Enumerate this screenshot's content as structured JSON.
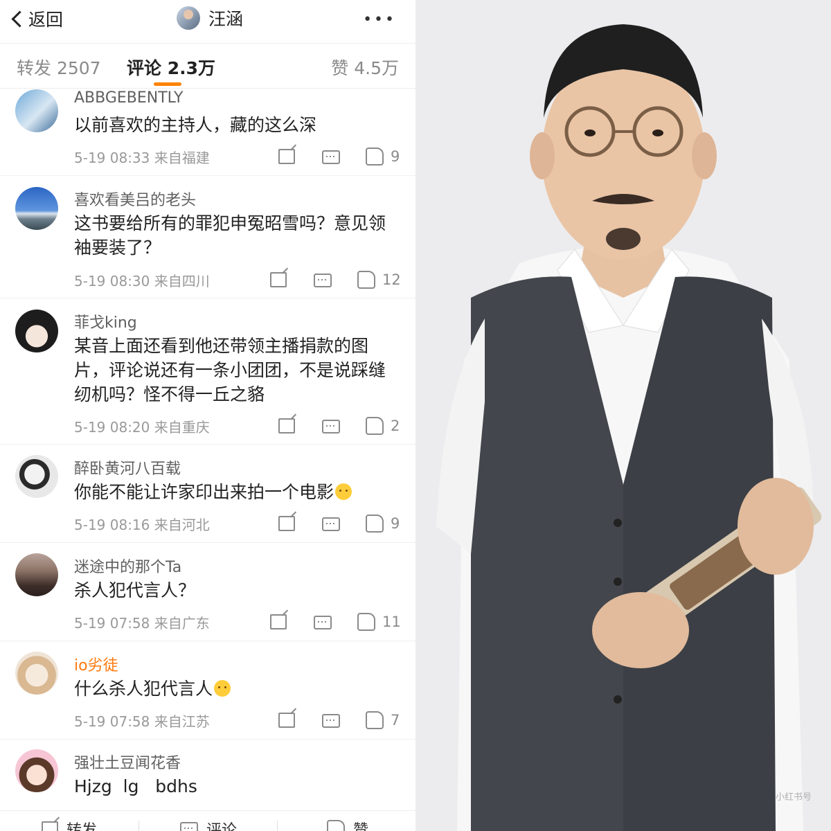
{
  "header": {
    "back_label": "返回",
    "title": "汪涵",
    "more": "•••"
  },
  "tabs": {
    "forward": "转发 2507",
    "comments": "评论 2.3万",
    "likes": "赞 4.5万"
  },
  "comments": [
    {
      "name": "ABBGEBENTLY",
      "text": "以前喜欢的主持人，藏的这么深",
      "meta": "5-19 08:33 来自福建",
      "likes": "9"
    },
    {
      "name": "喜欢看美吕的老头",
      "text": "这书要给所有的罪犯申冤昭雪吗？意见领袖要装了？",
      "meta": "5-19 08:30 来自四川",
      "likes": "12"
    },
    {
      "name": "菲戈king",
      "text": "某音上面还看到他还带领主播捐款的图片，评论说还有一条小团团，不是说踩缝纫机吗？怪不得一丘之貉",
      "meta": "5-19 08:20 来自重庆",
      "likes": "2"
    },
    {
      "name": "醉卧黄河八百载",
      "text": "你能不能让许家印出来拍一个电影",
      "meta": "5-19 08:16 来自河北",
      "likes": "9"
    },
    {
      "name": "迷途中的那个Ta",
      "text": "杀人犯代言人？",
      "meta": "5-19 07:58 来自广东",
      "likes": "11"
    },
    {
      "name": "io劣徒",
      "text": "什么杀人犯代言人",
      "meta": "5-19 07:58 来自江苏",
      "likes": "7"
    },
    {
      "name": "强壮土豆闻花香",
      "text": "Hjzg  lg   bdhs"
    }
  ],
  "bottom": {
    "forward": "转发",
    "comment": "评论",
    "like": "赞"
  },
  "photo": {
    "watermark": "小红书号"
  },
  "colors": {
    "accent": "#ff8200",
    "orange_name": "#ff7a0e"
  }
}
